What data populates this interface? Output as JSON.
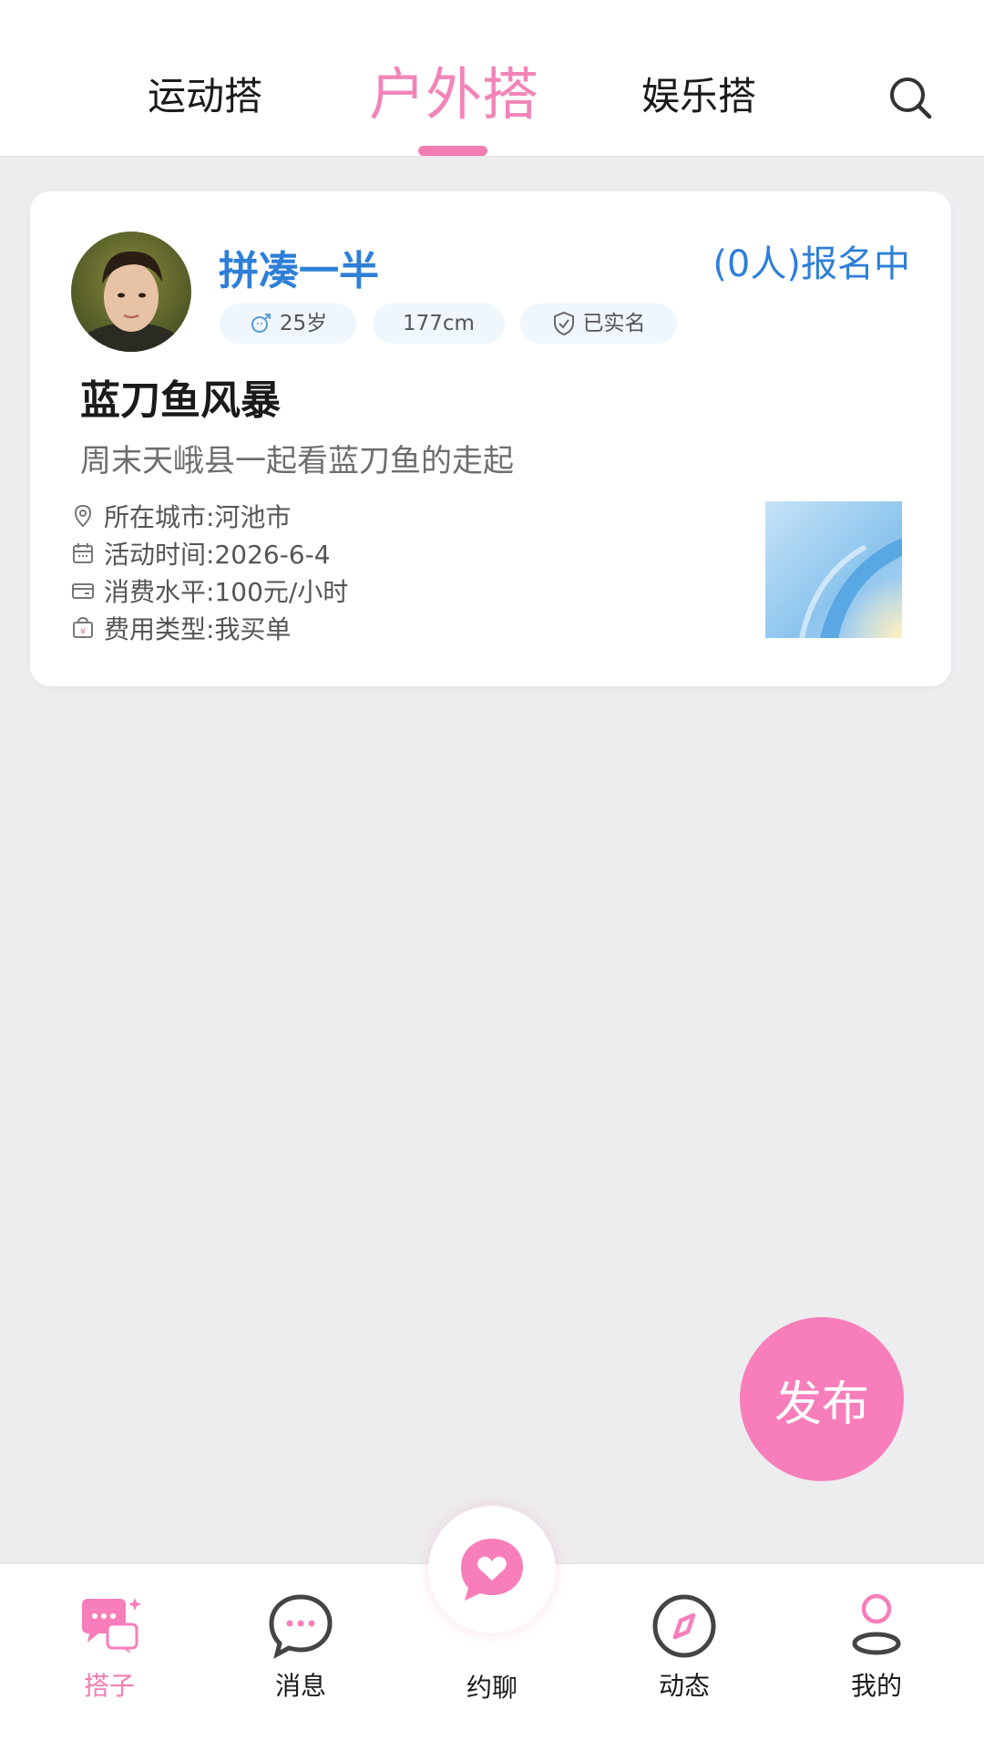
{
  "header": {
    "tabs": [
      {
        "label": "运动搭",
        "active": false
      },
      {
        "label": "户外搭",
        "active": true
      },
      {
        "label": "娱乐搭",
        "active": false
      }
    ],
    "search_icon": "search-icon"
  },
  "card": {
    "username": "拼凑一半",
    "status": "(0人)报名中",
    "tags": {
      "age": "25岁",
      "height": "177cm",
      "verified": "已实名"
    },
    "title": "蓝刀鱼风暴",
    "description": "周末天峨县一起看蓝刀鱼的走起",
    "info": {
      "city": "所在城市:河池市",
      "time": "活动时间:2026-6-4",
      "cost": "消费水平:100元/小时",
      "pay": "费用类型:我买单"
    }
  },
  "publish_label": "发布",
  "bottom_nav": [
    {
      "label": "搭子",
      "icon": "chat-bubbles-icon",
      "active": true
    },
    {
      "label": "消息",
      "icon": "message-dots-icon",
      "active": false
    },
    {
      "label": "约聊",
      "icon": "heart-chat-icon",
      "active": false
    },
    {
      "label": "动态",
      "icon": "compass-icon",
      "active": false
    },
    {
      "label": "我的",
      "icon": "user-icon",
      "active": false
    }
  ],
  "colors": {
    "accent_pink": "#f27db2",
    "link_blue": "#2e7fd8",
    "background": "#edecee"
  }
}
